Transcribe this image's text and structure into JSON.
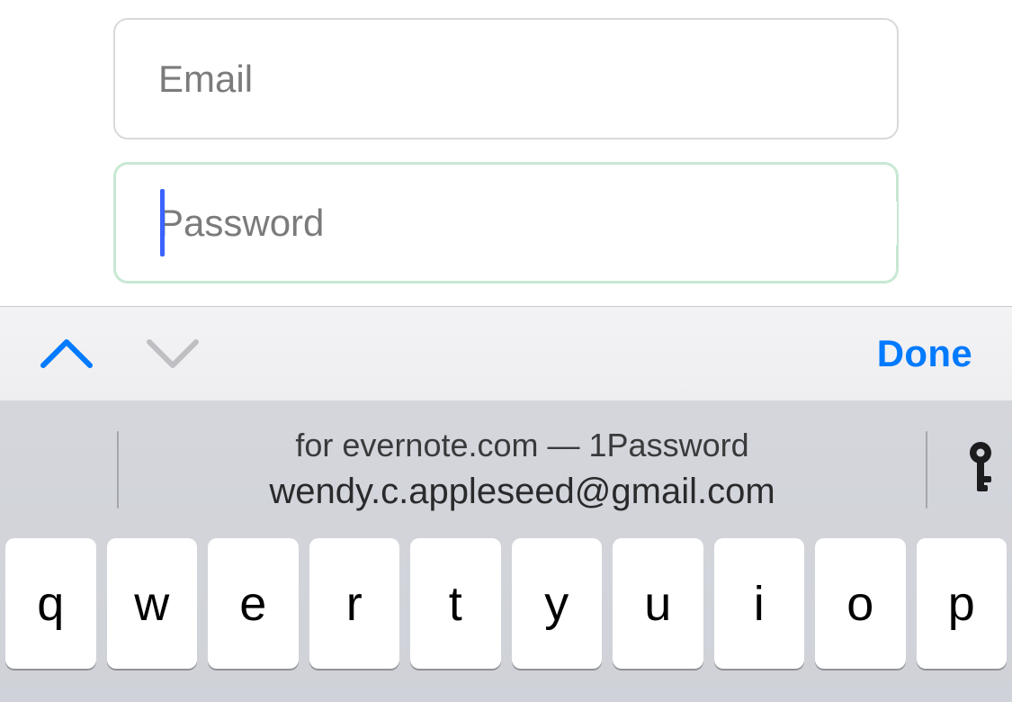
{
  "form": {
    "email": {
      "placeholder": "Email",
      "value": ""
    },
    "password": {
      "placeholder": "Password",
      "value": ""
    }
  },
  "accessory": {
    "done_label": "Done"
  },
  "autofill": {
    "context_line": "for evernote.com — 1Password",
    "account_line": "wendy.c.appleseed@gmail.com"
  },
  "keyboard": {
    "row1": [
      "q",
      "w",
      "e",
      "r",
      "t",
      "y",
      "u",
      "i",
      "o",
      "p"
    ]
  }
}
